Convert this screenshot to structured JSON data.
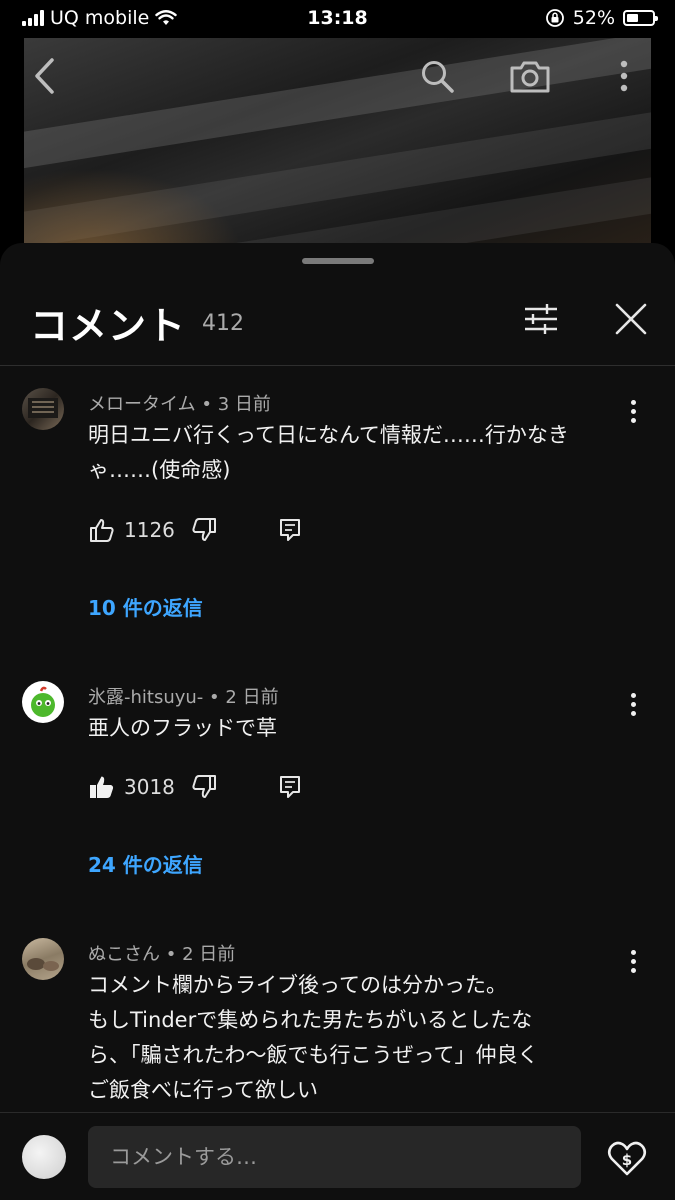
{
  "status_bar": {
    "carrier": "UQ mobile",
    "time": "13:18",
    "battery": "52%",
    "battery_level": 0.52
  },
  "video_header": {
    "back_icon": "chevron-left-icon",
    "search_icon": "search-icon",
    "cast_icon": "camera-icon",
    "more_icon": "more-vertical-icon"
  },
  "panel": {
    "title": "コメント",
    "count": "412",
    "filter_icon": "sliders-icon",
    "close_icon": "close-icon"
  },
  "comments": [
    {
      "author": "メロータイム",
      "sep": "•",
      "time": "3 日前",
      "lines": [
        "明日ユニバ行くって日になんて情報だ……行かなき",
        "ゃ……(使命感)"
      ],
      "likes": "1126",
      "liked": false,
      "replies": "10 件の返信"
    },
    {
      "author": "氷露-hitsuyu-",
      "sep": "•",
      "time": "2 日前",
      "lines": [
        "亜人のフラッドで草"
      ],
      "likes": "3018",
      "liked": true,
      "replies": "24 件の返信"
    },
    {
      "author": "ぬこさん",
      "sep": "•",
      "time": "2 日前",
      "lines": [
        "コメント欄からライブ後ってのは分かった。",
        "もしTinderで集められた男たちがいるとしたな",
        "ら、「騙されたわ〜飯でも行こうぜって」仲良く",
        "ご飯食べに行って欲しい"
      ]
    }
  ],
  "input": {
    "placeholder": "コメントする…",
    "thanks_icon": "heart-dollar-icon"
  },
  "colors": {
    "panel_bg": "#0f0f0f",
    "link": "#3ea6ff",
    "text": "#f1f1f1",
    "muted": "#aaaaaa"
  }
}
